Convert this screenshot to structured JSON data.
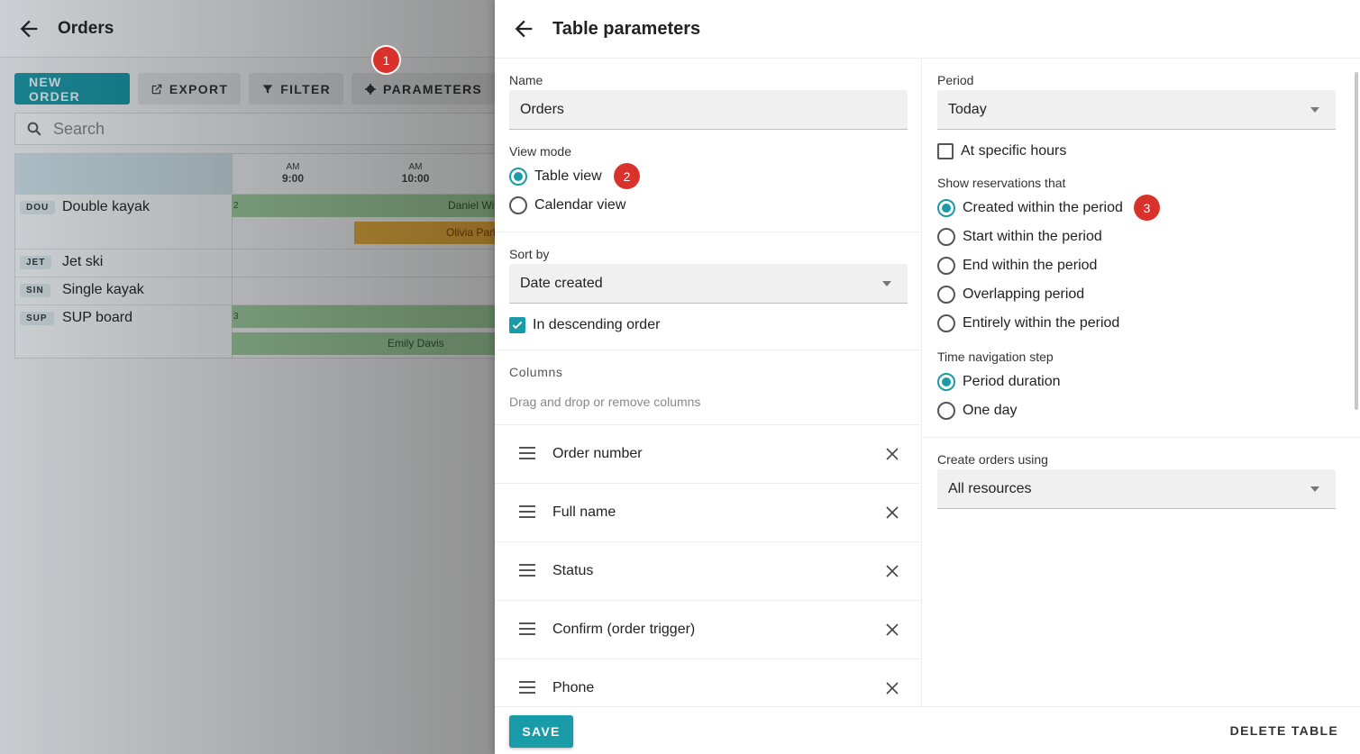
{
  "background": {
    "title": "Orders",
    "toolbar": {
      "new_order": "NEW ORDER",
      "export": "EXPORT",
      "filter": "FILTER",
      "parameters": "PARAMETERS"
    },
    "search_placeholder": "Search",
    "grid": {
      "ticks": [
        {
          "period": "AM",
          "time": "9:00"
        },
        {
          "period": "AM",
          "time": "10:00"
        }
      ],
      "rows": [
        {
          "code": "DOU",
          "name": "Double kayak"
        },
        {
          "code": "JET",
          "name": "Jet ski"
        },
        {
          "code": "SIN",
          "name": "Single kayak"
        },
        {
          "code": "SUP",
          "name": "SUP board"
        }
      ],
      "bars": [
        {
          "count": "2",
          "label": "Daniel Wil"
        },
        {
          "label": "Olivia Park"
        },
        {
          "count": "3",
          "label": ""
        },
        {
          "label": "Emily Davis"
        }
      ]
    }
  },
  "badges": [
    "1",
    "2",
    "3"
  ],
  "drawer": {
    "title": "Table parameters",
    "name_label": "Name",
    "name_value": "Orders",
    "view_mode_label": "View mode",
    "view_modes": [
      {
        "label": "Table view",
        "selected": true
      },
      {
        "label": "Calendar view",
        "selected": false
      }
    ],
    "sort_by_label": "Sort by",
    "sort_by_value": "Date created",
    "descending_label": "In descending order",
    "descending_checked": true,
    "columns_heading": "Columns",
    "columns_hint": "Drag and drop or remove columns",
    "columns": [
      "Order number",
      "Full name",
      "Status",
      "Confirm (order trigger)",
      "Phone"
    ],
    "period_label": "Period",
    "period_value": "Today",
    "specific_hours_label": "At specific hours",
    "specific_hours_checked": false,
    "show_reservations_label": "Show reservations that",
    "reservation_options": [
      {
        "label": "Created within the period",
        "selected": true
      },
      {
        "label": "Start within the period",
        "selected": false
      },
      {
        "label": "End within the period",
        "selected": false
      },
      {
        "label": "Overlapping period",
        "selected": false
      },
      {
        "label": "Entirely within the period",
        "selected": false
      }
    ],
    "time_step_label": "Time navigation step",
    "time_step_options": [
      {
        "label": "Period duration",
        "selected": true
      },
      {
        "label": "One day",
        "selected": false
      }
    ],
    "create_orders_label": "Create orders using",
    "create_orders_value": "All resources",
    "save_label": "SAVE",
    "delete_label": "DELETE TABLE"
  },
  "colors": {
    "accent": "#1a9ba8",
    "badge": "#d9322c"
  }
}
